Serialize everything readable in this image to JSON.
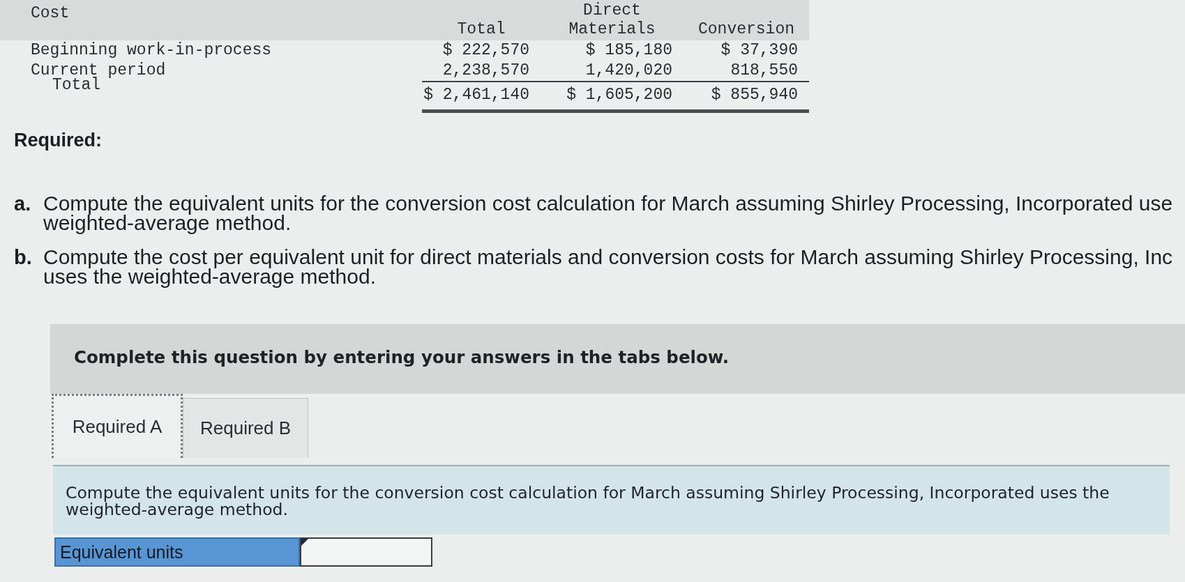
{
  "cost_table": {
    "title": "Cost",
    "columns": [
      "Total",
      "Direct Materials",
      "Conversion"
    ],
    "rows": [
      {
        "label": "Beginning work-in-process",
        "kind": "amount",
        "values": [
          "$ 222,570",
          "$ 185,180",
          "$ 37,390"
        ]
      },
      {
        "label": "Current period",
        "kind": "amount",
        "values": [
          "2,238,570",
          "1,420,020",
          "818,550"
        ]
      },
      {
        "label": "Total",
        "kind": "total",
        "values": [
          "$ 2,461,140",
          "$ 1,605,200",
          "$ 855,940"
        ]
      }
    ]
  },
  "required": {
    "heading": "Required:",
    "items": [
      {
        "marker": "a.",
        "lines": [
          "Compute the equivalent units for the conversion cost calculation for March assuming Shirley Processing, Incorporated use",
          "weighted-average method."
        ]
      },
      {
        "marker": "b.",
        "lines": [
          "Compute the cost per equivalent unit for direct materials and conversion costs for March assuming Shirley Processing, Inc",
          "uses the weighted-average method."
        ]
      }
    ]
  },
  "instruction_banner": "Complete this question by entering your answers in the tabs below.",
  "tabs": [
    {
      "label": "Required A",
      "selected": true
    },
    {
      "label": "Required B",
      "selected": false
    }
  ],
  "tab_panel": {
    "prompt": "Compute the equivalent units for the conversion cost calculation for March assuming Shirley Processing, Incorporated uses the weighted-average method.",
    "answer_rows": [
      {
        "label": "Equivalent units"
      }
    ]
  }
}
